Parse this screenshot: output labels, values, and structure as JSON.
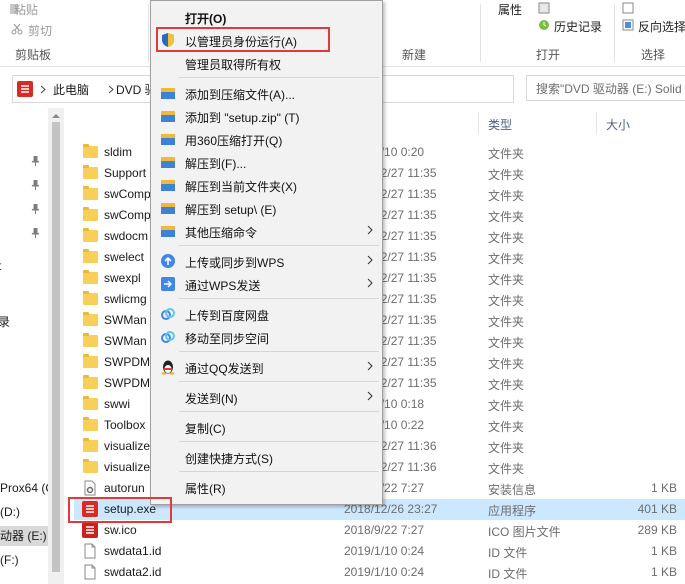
{
  "ribbon": {
    "paste": "粘贴",
    "cut": "剪切",
    "clipboard_group": "剪贴板",
    "new_group": "新建",
    "properties": "属性",
    "history": "历史记录",
    "open_group": "打开",
    "invert_selection": "反向选择",
    "select_group": "选择"
  },
  "address": {
    "root": "此电脑",
    "current": "DVD 驱",
    "search_placeholder": "搜索\"DVD 驱动器 (E:) Solid"
  },
  "nav": {
    "items": [
      {
        "label": "Prox64 (C"
      },
      {
        "label": "(D:)"
      },
      {
        "label": "动器 (E:)"
      },
      {
        "label": "(F:)"
      }
    ],
    "side_chars": [
      "t",
      "录"
    ]
  },
  "columns": {
    "type": "类型",
    "size": "大小"
  },
  "files": [
    {
      "name": "sldim",
      "date": "2019/1/10 0:20",
      "type": "文件夹",
      "size": "",
      "icon": "folder-icon"
    },
    {
      "name": "Support",
      "date": "2018/12/27 11:35",
      "type": "文件夹",
      "size": "",
      "icon": "folder-icon"
    },
    {
      "name": "swComp",
      "date": "2018/12/27 11:35",
      "type": "文件夹",
      "size": "",
      "icon": "folder-icon"
    },
    {
      "name": "swComp",
      "date": "2018/12/27 11:35",
      "type": "文件夹",
      "size": "",
      "icon": "folder-icon"
    },
    {
      "name": "swdocm",
      "date": "2018/12/27 11:35",
      "type": "文件夹",
      "size": "",
      "icon": "folder-icon"
    },
    {
      "name": "swelect",
      "date": "2018/12/27 11:35",
      "type": "文件夹",
      "size": "",
      "icon": "folder-icon"
    },
    {
      "name": "swexpl",
      "date": "2018/12/27 11:35",
      "type": "文件夹",
      "size": "",
      "icon": "folder-icon"
    },
    {
      "name": "swlicmg",
      "date": "2018/12/27 11:35",
      "type": "文件夹",
      "size": "",
      "icon": "folder-icon"
    },
    {
      "name": "SWMan",
      "date": "2018/12/27 11:35",
      "type": "文件夹",
      "size": "",
      "icon": "folder-icon"
    },
    {
      "name": "SWMan",
      "date": "2018/12/27 11:35",
      "type": "文件夹",
      "size": "",
      "icon": "folder-icon"
    },
    {
      "name": "SWPDM",
      "date": "2018/12/27 11:35",
      "type": "文件夹",
      "size": "",
      "icon": "folder-icon"
    },
    {
      "name": "SWPDM",
      "date": "2018/12/27 11:35",
      "type": "文件夹",
      "size": "",
      "icon": "folder-icon"
    },
    {
      "name": "swwi",
      "date": "2019/1/10 0:18",
      "type": "文件夹",
      "size": "",
      "icon": "folder-icon"
    },
    {
      "name": "Toolbox",
      "date": "2019/1/10 0:22",
      "type": "文件夹",
      "size": "",
      "icon": "folder-icon"
    },
    {
      "name": "visualize",
      "date": "2018/12/27 11:36",
      "type": "文件夹",
      "size": "",
      "icon": "folder-icon"
    },
    {
      "name": "visualize",
      "date": "2018/12/27 11:36",
      "type": "文件夹",
      "size": "",
      "icon": "folder-icon"
    },
    {
      "name": "autorun",
      "date": "2018/2/22 7:27",
      "type": "安装信息",
      "size": "1 KB",
      "icon": "settings-file-icon"
    },
    {
      "name": "setup.exe",
      "date": "2018/12/26 23:27",
      "type": "应用程序",
      "size": "401 KB",
      "icon": "solidworks-exe-icon"
    },
    {
      "name": "sw.ico",
      "date": "2018/9/22 7:27",
      "type": "ICO 图片文件",
      "size": "289 KB",
      "icon": "solidworks-ico-icon"
    },
    {
      "name": "swdata1.id",
      "date": "2019/1/10 0:24",
      "type": "ID 文件",
      "size": "1 KB",
      "icon": "file-icon"
    },
    {
      "name": "swdata2.id",
      "date": "2019/1/10 0:24",
      "type": "ID 文件",
      "size": "1 KB",
      "icon": "file-icon"
    }
  ],
  "menu": {
    "open": "打开(O)",
    "run_as_admin": "以管理员身份运行(A)",
    "take_ownership": "管理员取得所有权",
    "add_to_archive": "添加到压缩文件(A)...",
    "add_to_zip": "添加到 \"setup.zip\" (T)",
    "open_360": "用360压缩打开(Q)",
    "extract_to": "解压到(F)...",
    "extract_here": "解压到当前文件夹(X)",
    "extract_setup": "解压到 setup\\ (E)",
    "other_compress": "其他压缩命令",
    "upload_wps": "上传或同步到WPS",
    "send_wps": "通过WPS发送",
    "upload_baidu": "上传到百度网盘",
    "move_sync": "移动至同步空间",
    "send_qq": "通过QQ发送到",
    "send_to": "发送到(N)",
    "copy": "复制(C)",
    "create_shortcut": "创建快捷方式(S)",
    "properties": "属性(R)"
  },
  "colors": {
    "highlight": "#e23a3a",
    "selection": "#cce8ff",
    "folder": "#f7cf59"
  }
}
